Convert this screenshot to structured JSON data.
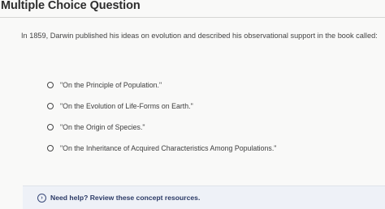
{
  "header": {
    "title": "Multiple Choice Question"
  },
  "question": {
    "text": "In 1859, Darwin published his ideas on evolution and described his observational support in the book called:"
  },
  "options": [
    {
      "label": "\"On the Principle of Population.\""
    },
    {
      "label": "\"On the Evolution of Life-Forms on Earth.\""
    },
    {
      "label": "\"On the Origin of Species.\""
    },
    {
      "label": "\"On the Inheritance of Acquired Characteristics Among Populations.\""
    }
  ],
  "help": {
    "icon": "chevron-right-circle-icon",
    "label": "Need help? Review these concept resources."
  }
}
